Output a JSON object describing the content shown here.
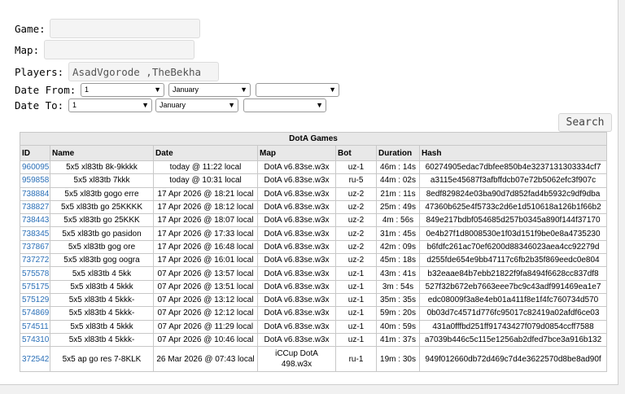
{
  "form": {
    "game_label": "Game:",
    "map_label": "Map:",
    "players_label": "Players:",
    "players_value": "AsadVgorode ,TheBekha",
    "date_from_label": "Date From:",
    "date_to_label": "Date To:",
    "from_day": "1",
    "from_month": "January",
    "from_year": "",
    "to_day": "1",
    "to_month": "January",
    "to_year": "",
    "search_label": "Search"
  },
  "table": {
    "caption": "DotA Games",
    "headers": [
      "ID",
      "Name",
      "Date",
      "Map",
      "Bot",
      "Duration",
      "Hash"
    ],
    "rows": [
      [
        "960095",
        "5x5 xl83tb 8k-9kkkk",
        "today @ 11:22 local",
        "DotA v6.83se.w3x",
        "uz-1",
        "46m : 14s",
        "60274905edac7dbfee850b4e3237131303334cf7"
      ],
      [
        "959858",
        "5x5 xl83tb 7kkk",
        "today @ 10:31 local",
        "DotA v6.83se.w3x",
        "ru-5",
        "44m : 02s",
        "a3115e45687f3afbffdcb07e72b5062efc3f907c"
      ],
      [
        "738884",
        "5x5 xl83tb gogo erre",
        "17 Apr 2026 @ 18:21 local",
        "DotA v6.83se.w3x",
        "uz-2",
        "21m : 11s",
        "8edf829824e03ba90d7d852fad4b5932c9df9dba"
      ],
      [
        "738827",
        "5x5 xl83tb go 25KKKK",
        "17 Apr 2026 @ 18:12 local",
        "DotA v6.83se.w3x",
        "uz-2",
        "25m : 49s",
        "47360b625e4f5733c2d6e1d510618a126b1f66b2"
      ],
      [
        "738443",
        "5x5 xl83tb go 25KKK",
        "17 Apr 2026 @ 18:07 local",
        "DotA v6.83se.w3x",
        "uz-2",
        "4m : 56s",
        "849e217bdbf054685d257b0345a890f144f37170"
      ],
      [
        "738345",
        "5x5 xl83tb go pasidon",
        "17 Apr 2026 @ 17:33 local",
        "DotA v6.83se.w3x",
        "uz-2",
        "31m : 45s",
        "0e4b27f1d8008530e1f03d151f9be0e8a4735230"
      ],
      [
        "737867",
        "5x5 xl83tb gog ore",
        "17 Apr 2026 @ 16:48 local",
        "DotA v6.83se.w3x",
        "uz-2",
        "42m : 09s",
        "b6fdfc261ac70ef6200d88346023aea4cc92279d"
      ],
      [
        "737272",
        "5x5 xl83tb gog oogra",
        "17 Apr 2026 @ 16:01 local",
        "DotA v6.83se.w3x",
        "uz-2",
        "45m : 18s",
        "d255fde654e9bb47117c6fb2b35f869eedc0e804"
      ],
      [
        "575578",
        "5x5 xl83tb 4 5kk",
        "07 Apr 2026 @ 13:57 local",
        "DotA v6.83se.w3x",
        "uz-1",
        "43m : 41s",
        "b32eaae84b7ebb21822f9fa8494f6628cc837df8"
      ],
      [
        "575175",
        "5x5 xl83tb 4 5kkk",
        "07 Apr 2026 @ 13:51 local",
        "DotA v6.83se.w3x",
        "uz-1",
        "3m : 54s",
        "527f32b672eb7663eee7bc9c43adf991469ea1e7"
      ],
      [
        "575129",
        "5x5 xl83tb 4 5kkk-",
        "07 Apr 2026 @ 13:12 local",
        "DotA v6.83se.w3x",
        "uz-1",
        "35m : 35s",
        "edc08009f3a8e4eb01a411f8e1f4fc760734d570"
      ],
      [
        "574869",
        "5x5 xl83tb 4 5kkk-",
        "07 Apr 2026 @ 12:12 local",
        "DotA v6.83se.w3x",
        "uz-1",
        "59m : 20s",
        "0b03d7c4571d776fc95017c82419a02afdf6ce03"
      ],
      [
        "574511",
        "5x5 xl83tb 4 5kkk",
        "07 Apr 2026 @ 11:29 local",
        "DotA v6.83se.w3x",
        "uz-1",
        "40m : 59s",
        "431a0fffbd251ff91743427f079d0854ccff7588"
      ],
      [
        "574310",
        "5x5 xl83tb 4 5kkk-",
        "07 Apr 2026 @ 10:46 local",
        "DotA v6.83se.w3x",
        "uz-1",
        "41m : 37s",
        "a7039b446c5c115e1256ab2dfed7bce3a916b132"
      ],
      [
        "372542",
        "5x5 ap go res 7-8KLK",
        "26 Mar 2026 @ 07:43 local",
        "iCCup DotA 498.w3x",
        "ru-1",
        "19m : 30s",
        "949f012660db72d469c7d4e3622570d8be8ad90f"
      ]
    ]
  }
}
